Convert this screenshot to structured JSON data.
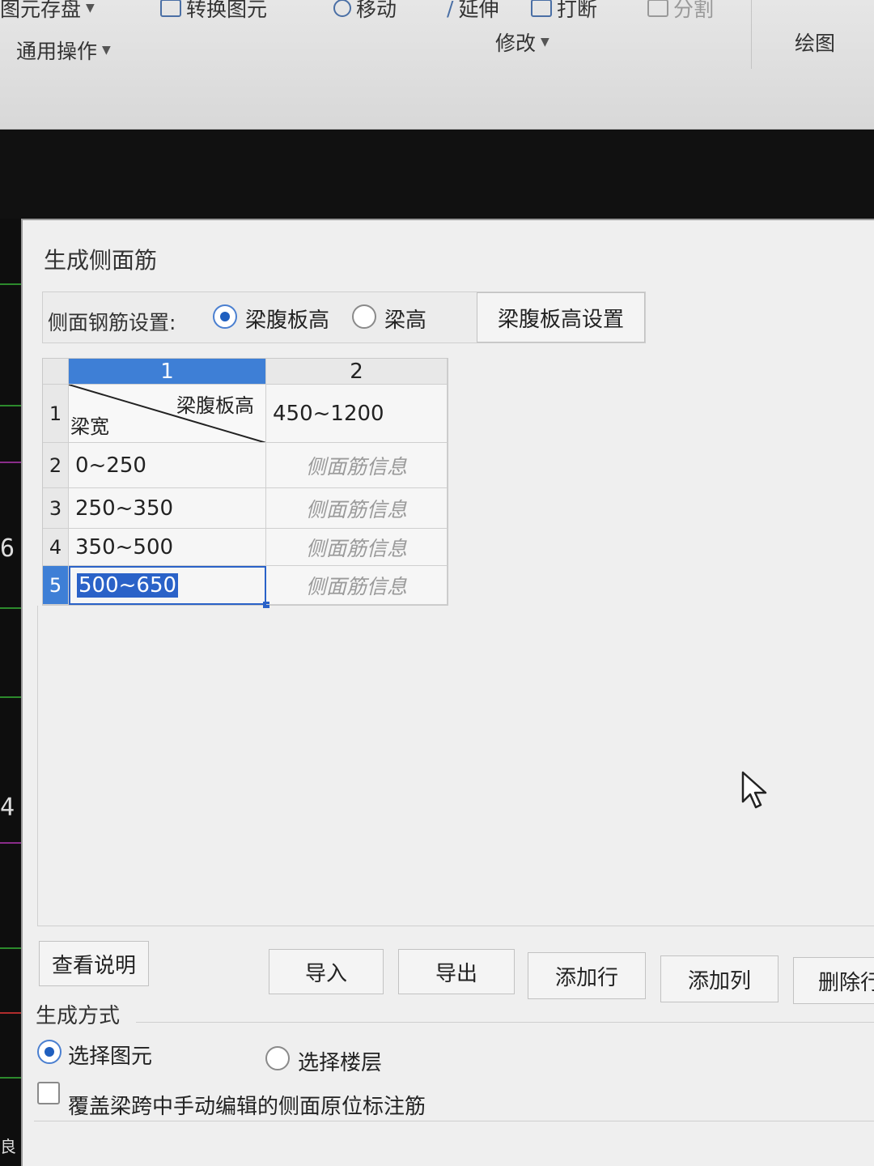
{
  "ribbon": {
    "top_items": [
      {
        "name": "element-save",
        "label": "图元存盘"
      },
      {
        "name": "convert-element",
        "label": "转换图元"
      },
      {
        "name": "move",
        "label": "移动"
      },
      {
        "name": "extend",
        "label": "延伸"
      },
      {
        "name": "break",
        "label": "打断"
      },
      {
        "name": "split",
        "label": "分割"
      }
    ],
    "groups": {
      "general": "通用操作",
      "modify": "修改",
      "draw": "绘图"
    }
  },
  "left_strip": {
    "label_a": "6",
    "label_b": "4",
    "label_c": "良"
  },
  "dialog": {
    "title": "生成侧面筋",
    "setting_label": "侧面钢筋设置:",
    "radio_web_height": "梁腹板高",
    "radio_beam_height": "梁高",
    "web_height_settings_button": "梁腹板高设置",
    "grid": {
      "col_headers": [
        "1",
        "2"
      ],
      "corner_top": "梁腹板高",
      "corner_bottom": "梁宽",
      "header_value": "450~1200",
      "rows": [
        {
          "num": "1"
        },
        {
          "num": "2",
          "width": "0~250",
          "info": "侧面筋信息"
        },
        {
          "num": "3",
          "width": "250~350",
          "info": "侧面筋信息"
        },
        {
          "num": "4",
          "width": "350~500",
          "info": "侧面筋信息"
        },
        {
          "num": "5",
          "width": "500~650",
          "info": "侧面筋信息"
        }
      ]
    },
    "buttons": {
      "view_help": "查看说明",
      "import": "导入",
      "export": "导出",
      "add_row": "添加行",
      "add_col": "添加列",
      "delete": "删除行"
    },
    "generation": {
      "title": "生成方式",
      "select_element": "选择图元",
      "select_floor": "选择楼层",
      "override_label": "覆盖梁跨中手动编辑的侧面原位标注筋"
    }
  }
}
